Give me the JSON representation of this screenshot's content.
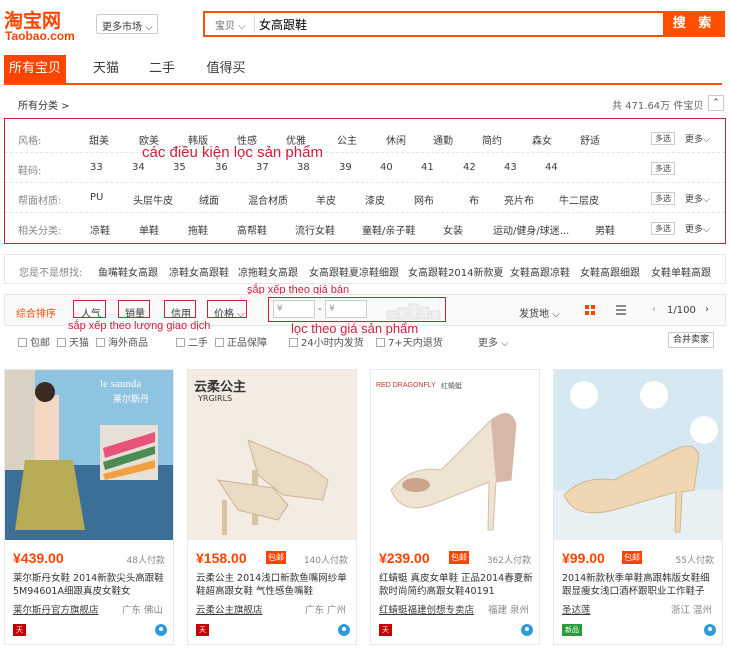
{
  "header": {
    "logo_cn": "淘宝网",
    "logo_en": "Taobao.com",
    "more_market": "更多市场 ⌵",
    "search_category": "宝贝 ⌵",
    "search_query": "女高跟鞋",
    "search_button": "搜 索"
  },
  "tabs": [
    "所有宝贝",
    "天猫",
    "二手",
    "值得买"
  ],
  "breadcrumb": "所有分类 >",
  "total": "共 471.64万 件宝贝",
  "collapse": "⌃",
  "filters": {
    "annotation": "các điều kiện lọc sản phẩm",
    "multi": "多选",
    "more": "更多⌵",
    "rows": [
      {
        "label": "风格:",
        "values": [
          "甜美",
          "欧美",
          "韩版",
          "性感",
          "优雅",
          "公主",
          "休闲",
          "通勤",
          "简约",
          "森女",
          "舒适"
        ]
      },
      {
        "label": "鞋码:",
        "values": [
          "33",
          "34",
          "35",
          "36",
          "37",
          "38",
          "39",
          "40",
          "41",
          "42",
          "43",
          "44"
        ]
      },
      {
        "label": "帮面材质:",
        "values": [
          "PU",
          "头层牛皮",
          "绒面",
          "混合材质",
          "羊皮",
          "漆皮",
          "网布",
          "布",
          "亮片布",
          "牛二层皮"
        ]
      },
      {
        "label": "相关分类:",
        "values": [
          "凉鞋",
          "单鞋",
          "拖鞋",
          "高帮鞋",
          "流行女鞋",
          "童鞋/亲子鞋",
          "女装",
          "运动/健身/球迷...",
          "男鞋"
        ]
      }
    ]
  },
  "suggest": {
    "label": "您是不是想找:",
    "items": [
      "鱼嘴鞋女高跟",
      "凉鞋女高跟鞋",
      "凉拖鞋女高跟",
      "女高跟鞋夏凉鞋细跟",
      "女高跟鞋2014新款夏",
      "女鞋高跟凉鞋",
      "女鞋高跟细跟",
      "女鞋单鞋高跟"
    ]
  },
  "sort": {
    "default": "综合排序",
    "popularity": "人气",
    "sales": "销量",
    "credit": "信用",
    "price": "价格 ⌵",
    "price_min_placeholder": "¥",
    "price_sep": "-",
    "price_max_placeholder": "¥",
    "ship_from": "发货地 ⌵",
    "page": "1/100",
    "annot_price_sort": "sắp xếp theo giá bán",
    "annot_volume_sort": "sắp xếp theo lượng giao dịch",
    "annot_price_filter": "lọc theo giá sản phẩm"
  },
  "checks": [
    "包邮",
    "天猫",
    "海外商品",
    "二手",
    "正品保障",
    "24小时内发货",
    "7+天内退货"
  ],
  "checks_more": "更多 ⌵",
  "merge_sellers": "合并卖家",
  "products": [
    {
      "price": "¥439.00",
      "badge": "",
      "buyers": "48人付款",
      "title": "莱尔斯丹女鞋 2014新款尖头高跟鞋5M94601A细跟真皮女鞋女",
      "shop": "莱尔斯丹官方旗舰店",
      "location": "广东 佛山",
      "img_brand": "le saunda",
      "img_sub": "莱尔斯丹"
    },
    {
      "price": "¥158.00",
      "badge": "包邮",
      "buyers": "140人付款",
      "title": "云柔公主 2014浅口新款鱼嘴网纱单鞋超高跟女鞋 气性感鱼嘴鞋",
      "shop": "云柔公主旗舰店",
      "location": "广东 广州",
      "img_brand": "云柔公主",
      "img_sub": "YRGIRLS"
    },
    {
      "price": "¥239.00",
      "badge": "包邮",
      "buyers": "362人付款",
      "title": "红蜻蜓 真皮女单鞋 正品2014春夏新款时尚简约高跟女鞋40191",
      "shop": "红蜻蜓福建创想专卖店",
      "location": "福建 泉州",
      "img_brand": "RED DRAGONFLY",
      "img_sub": "红蜻蜓"
    },
    {
      "price": "¥99.00",
      "badge": "包邮",
      "buyers": "55人付款",
      "title": "2014新款秋季单鞋高跟韩版女鞋细跟显瘦女浅口酒杯跟职业工作鞋子",
      "shop": "圣达莲",
      "location": "浙江 温州",
      "img_brand": "",
      "img_sub": ""
    }
  ],
  "colors": {
    "accent": "#ff4400",
    "annotation": "#cc1f3a"
  }
}
